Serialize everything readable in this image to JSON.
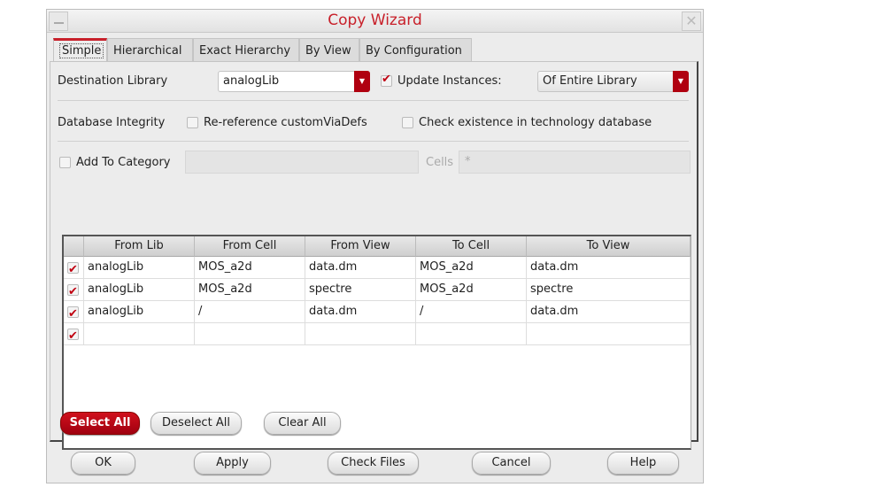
{
  "window": {
    "title": "Copy Wizard"
  },
  "tabs": [
    "Simple",
    "Hierarchical",
    "Exact Hierarchy",
    "By View",
    "By Configuration"
  ],
  "destination": {
    "label": "Destination Library",
    "value": "analogLib",
    "update_label": "Update Instances:",
    "update_checked": true,
    "update_value": "Of Entire Library"
  },
  "integrity": {
    "label": "Database Integrity",
    "reref": "Re-reference customViaDefs",
    "check": "Check existence in technology database"
  },
  "category": {
    "label": "Add To Category",
    "value": "",
    "cells_label": "Cells",
    "cells_value": "*"
  },
  "table": {
    "headers": [
      "From Lib",
      "From Cell",
      "From View",
      "To Cell",
      "To View"
    ],
    "rows": [
      [
        "analogLib",
        "MOS_a2d",
        "data.dm",
        "MOS_a2d",
        "data.dm"
      ],
      [
        "analogLib",
        "MOS_a2d",
        "spectre",
        "MOS_a2d",
        "spectre"
      ],
      [
        "analogLib",
        "/",
        "data.dm",
        "/",
        "data.dm"
      ],
      [
        "",
        "",
        "",
        "",
        ""
      ]
    ]
  },
  "table_buttons": {
    "select_all": "Select All",
    "deselect_all": "Deselect All",
    "clear_all": "Clear All"
  },
  "buttons": {
    "ok": "OK",
    "apply": "Apply",
    "check_files": "Check Files",
    "cancel": "Cancel",
    "help": "Help"
  }
}
